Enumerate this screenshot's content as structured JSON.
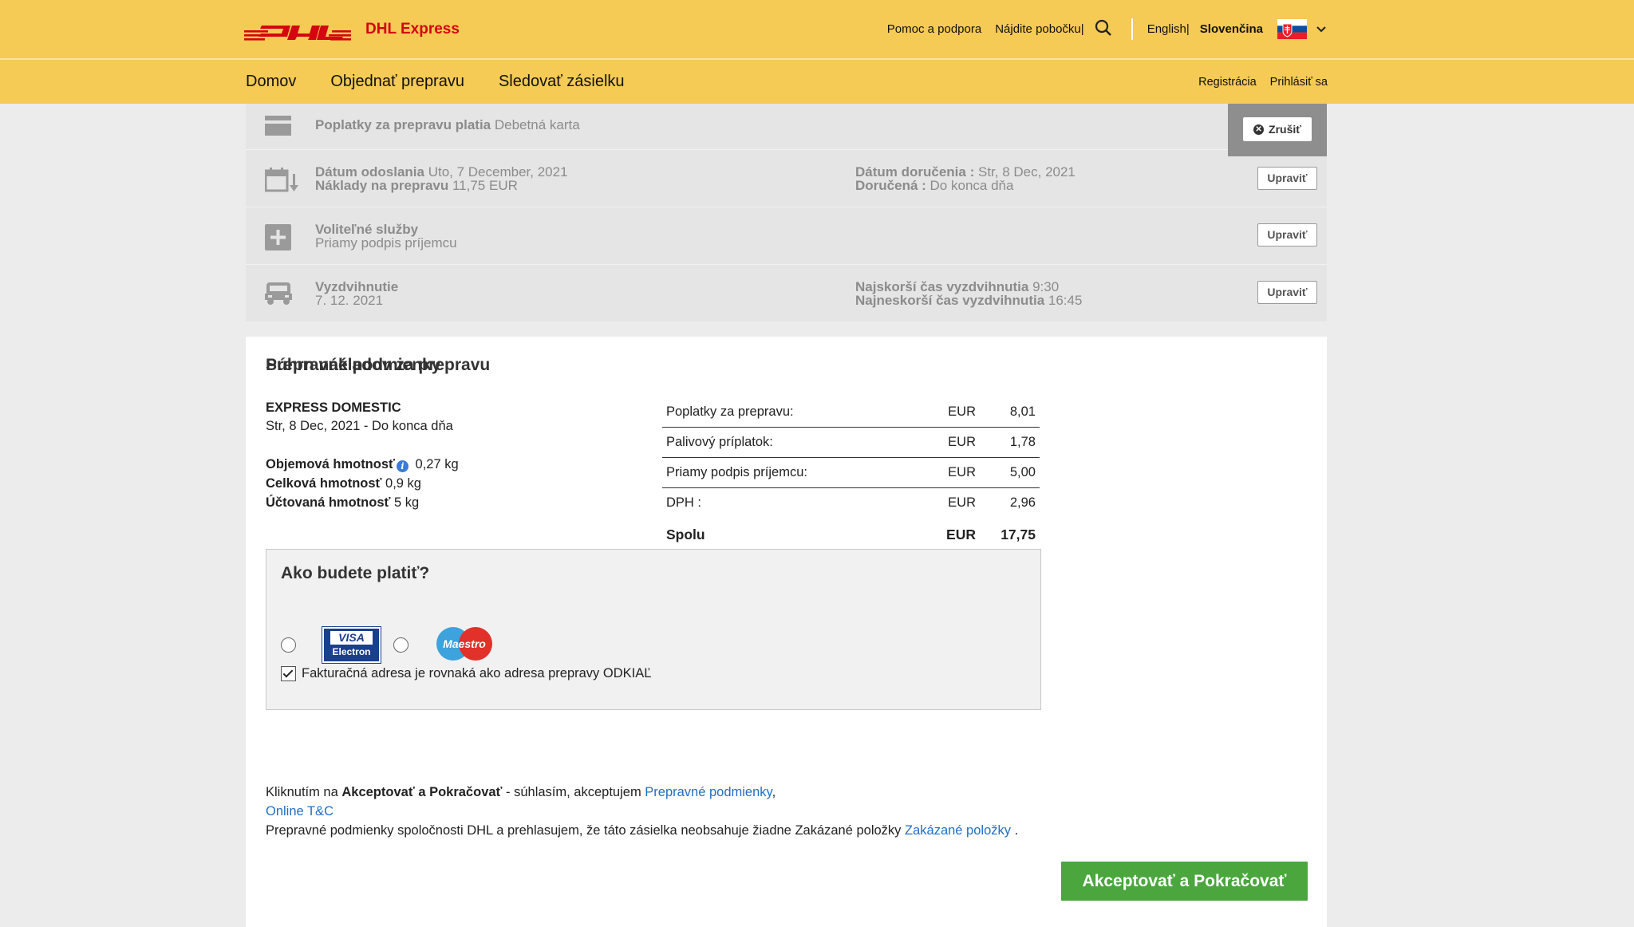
{
  "header": {
    "brand_label": "DHL Express",
    "links": [
      "Pomoc a podpora",
      "Nájdite pobočku"
    ],
    "lang_en": "English",
    "lang_sk": "Slovenčina"
  },
  "nav": {
    "items": [
      "Domov",
      "Objednať prepravu",
      "Sledovať zásielku"
    ],
    "register": "Registrácia",
    "login": "Prihlásiť sa"
  },
  "summary": {
    "cancel_label": "Zrušiť",
    "edit_label": "Upraviť",
    "payment": {
      "label": "Poplatky za prepravu platia",
      "value": "Debetná karta"
    },
    "dates": {
      "ship_label": "Dátum odoslania",
      "ship_value": "Uto, 7 December, 2021",
      "cost_label": "Náklady na prepravu",
      "cost_value": "11,75 EUR",
      "delivery_label": "Dátum doručenia :",
      "delivery_value": "Str, 8 Dec, 2021",
      "delivered_label": "Doručená :",
      "delivered_value": "Do konca dňa"
    },
    "optional": {
      "label": "Voliteľné služby",
      "value": "Priamy podpis príjemcu"
    },
    "pickup": {
      "label": "Vyzdvihnutie",
      "value": "7. 12. 2021",
      "earliest_label": "Najskorší čas vyzdvihnutia",
      "earliest_value": "9:30",
      "latest_label": "Najneskorší čas vyzdvihnutia",
      "latest_value": "16:45"
    }
  },
  "costs": {
    "title": "Súhrn nákladov za prepravu",
    "service": "EXPRESS DOMESTIC",
    "service_date": "Str, 8 Dec, 2021 - Do konca dňa",
    "vol_weight_label": "Objemová hmotnosť",
    "vol_weight_value": "0,27 kg",
    "total_weight_label": "Celková hmotnosť",
    "total_weight_value": "0,9 kg",
    "billed_weight_label": "Účtovaná hmotnosť",
    "billed_weight_value": "5 kg",
    "rows": [
      {
        "label": "Poplatky za prepravu:",
        "currency": "EUR",
        "value": "8,01"
      },
      {
        "label": "Palivový príplatok:",
        "currency": "EUR",
        "value": "1,78"
      },
      {
        "label": "Priamy podpis príjemcu:",
        "currency": "EUR",
        "value": "5,00"
      },
      {
        "label": "DPH :",
        "currency": "EUR",
        "value": "2,96"
      }
    ],
    "total": {
      "label": "Spolu",
      "currency": "EUR",
      "value": "17,75"
    }
  },
  "payment": {
    "title": "Ako budete platiť?",
    "visa_line1": "VISA",
    "visa_line2": "Electron",
    "maestro_label": "Maestro",
    "billing_checkbox": "Fakturačná adresa je rovnaká ako adresa prepravy ODKIAĽ",
    "billing_checked": true
  },
  "terms": {
    "title": "Prepravné podmienky",
    "line1_prefix": "Kliknutím na ",
    "line1_bold": "Akceptovať a Pokračovať",
    "line1_mid": " - súhlasím, akceptujem ",
    "link_conditions": "Prepravné podmienky",
    "link_online": "Online T&C",
    "line3_text": "Prepravné podmienky spoločnosti DHL a prehlasujem, že táto zásielka neobsahuje žiadne Zakázané položky ",
    "link_forbidden": "Zakázané položky",
    "line3_end": " ."
  },
  "accept_button": "Akceptovať a Pokračovať"
}
